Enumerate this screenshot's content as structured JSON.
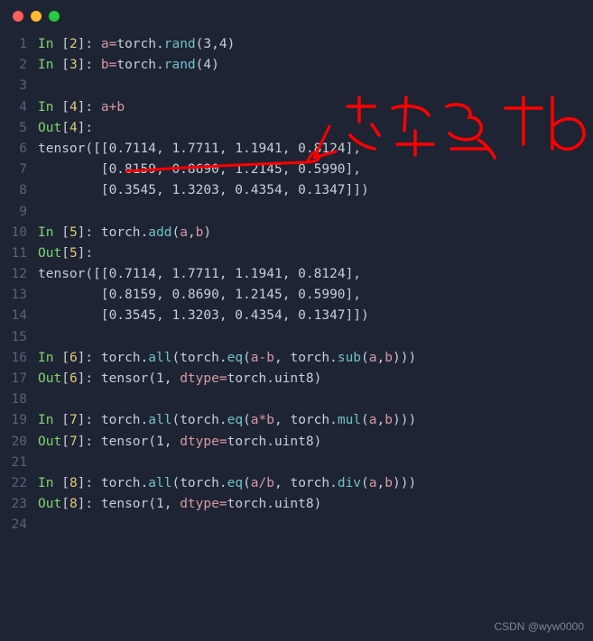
{
  "window": {
    "controls": [
      "close",
      "minimize",
      "maximize"
    ]
  },
  "lines": [
    {
      "n": "1",
      "tokens": [
        {
          "t": "In ",
          "c": "kw-in"
        },
        {
          "t": "[",
          "c": "plain"
        },
        {
          "t": "2",
          "c": "bracket-num"
        },
        {
          "t": "]: ",
          "c": "plain"
        },
        {
          "t": "a",
          "c": "var"
        },
        {
          "t": "=",
          "c": "op"
        },
        {
          "t": "torch.",
          "c": "plain"
        },
        {
          "t": "rand",
          "c": "func"
        },
        {
          "t": "(",
          "c": "paren"
        },
        {
          "t": "3",
          "c": "num"
        },
        {
          "t": ",",
          "c": "plain"
        },
        {
          "t": "4",
          "c": "num"
        },
        {
          "t": ")",
          "c": "paren"
        }
      ]
    },
    {
      "n": "2",
      "tokens": [
        {
          "t": "In ",
          "c": "kw-in"
        },
        {
          "t": "[",
          "c": "plain"
        },
        {
          "t": "3",
          "c": "bracket-num"
        },
        {
          "t": "]: ",
          "c": "plain"
        },
        {
          "t": "b",
          "c": "var"
        },
        {
          "t": "=",
          "c": "op"
        },
        {
          "t": "torch.",
          "c": "plain"
        },
        {
          "t": "rand",
          "c": "func"
        },
        {
          "t": "(",
          "c": "paren"
        },
        {
          "t": "4",
          "c": "num"
        },
        {
          "t": ")",
          "c": "paren"
        }
      ]
    },
    {
      "n": "3",
      "tokens": []
    },
    {
      "n": "4",
      "tokens": [
        {
          "t": "In ",
          "c": "kw-in"
        },
        {
          "t": "[",
          "c": "plain"
        },
        {
          "t": "4",
          "c": "bracket-num"
        },
        {
          "t": "]: ",
          "c": "plain"
        },
        {
          "t": "a",
          "c": "var"
        },
        {
          "t": "+",
          "c": "op"
        },
        {
          "t": "b",
          "c": "var"
        }
      ]
    },
    {
      "n": "5",
      "tokens": [
        {
          "t": "Out",
          "c": "kw-out"
        },
        {
          "t": "[",
          "c": "plain"
        },
        {
          "t": "4",
          "c": "bracket-num"
        },
        {
          "t": "]:",
          "c": "plain"
        }
      ]
    },
    {
      "n": "6",
      "tokens": [
        {
          "t": "tensor",
          "c": "plain"
        },
        {
          "t": "([[",
          "c": "paren"
        },
        {
          "t": "0.7114",
          "c": "num"
        },
        {
          "t": ", ",
          "c": "plain"
        },
        {
          "t": "1.7711",
          "c": "num"
        },
        {
          "t": ", ",
          "c": "plain"
        },
        {
          "t": "1.1941",
          "c": "num"
        },
        {
          "t": ", ",
          "c": "plain"
        },
        {
          "t": "0.8124",
          "c": "num"
        },
        {
          "t": "],",
          "c": "paren"
        }
      ]
    },
    {
      "n": "7",
      "tokens": [
        {
          "t": "        [",
          "c": "paren"
        },
        {
          "t": "0.8159",
          "c": "num"
        },
        {
          "t": ", ",
          "c": "plain"
        },
        {
          "t": "0.8690",
          "c": "num"
        },
        {
          "t": ", ",
          "c": "plain"
        },
        {
          "t": "1.2145",
          "c": "num"
        },
        {
          "t": ", ",
          "c": "plain"
        },
        {
          "t": "0.5990",
          "c": "num"
        },
        {
          "t": "],",
          "c": "paren"
        }
      ]
    },
    {
      "n": "8",
      "tokens": [
        {
          "t": "        [",
          "c": "paren"
        },
        {
          "t": "0.3545",
          "c": "num"
        },
        {
          "t": ", ",
          "c": "plain"
        },
        {
          "t": "1.3203",
          "c": "num"
        },
        {
          "t": ", ",
          "c": "plain"
        },
        {
          "t": "0.4354",
          "c": "num"
        },
        {
          "t": ", ",
          "c": "plain"
        },
        {
          "t": "0.1347",
          "c": "num"
        },
        {
          "t": "]])",
          "c": "paren"
        }
      ]
    },
    {
      "n": "9",
      "tokens": []
    },
    {
      "n": "10",
      "tokens": [
        {
          "t": "In ",
          "c": "kw-in"
        },
        {
          "t": "[",
          "c": "plain"
        },
        {
          "t": "5",
          "c": "bracket-num"
        },
        {
          "t": "]: ",
          "c": "plain"
        },
        {
          "t": "torch.",
          "c": "plain"
        },
        {
          "t": "add",
          "c": "func"
        },
        {
          "t": "(",
          "c": "paren"
        },
        {
          "t": "a",
          "c": "var"
        },
        {
          "t": ",",
          "c": "plain"
        },
        {
          "t": "b",
          "c": "var"
        },
        {
          "t": ")",
          "c": "paren"
        }
      ]
    },
    {
      "n": "11",
      "tokens": [
        {
          "t": "Out",
          "c": "kw-out"
        },
        {
          "t": "[",
          "c": "plain"
        },
        {
          "t": "5",
          "c": "bracket-num"
        },
        {
          "t": "]:",
          "c": "plain"
        }
      ]
    },
    {
      "n": "12",
      "tokens": [
        {
          "t": "tensor",
          "c": "plain"
        },
        {
          "t": "([[",
          "c": "paren"
        },
        {
          "t": "0.7114",
          "c": "num"
        },
        {
          "t": ", ",
          "c": "plain"
        },
        {
          "t": "1.7711",
          "c": "num"
        },
        {
          "t": ", ",
          "c": "plain"
        },
        {
          "t": "1.1941",
          "c": "num"
        },
        {
          "t": ", ",
          "c": "plain"
        },
        {
          "t": "0.8124",
          "c": "num"
        },
        {
          "t": "],",
          "c": "paren"
        }
      ]
    },
    {
      "n": "13",
      "tokens": [
        {
          "t": "        [",
          "c": "paren"
        },
        {
          "t": "0.8159",
          "c": "num"
        },
        {
          "t": ", ",
          "c": "plain"
        },
        {
          "t": "0.8690",
          "c": "num"
        },
        {
          "t": ", ",
          "c": "plain"
        },
        {
          "t": "1.2145",
          "c": "num"
        },
        {
          "t": ", ",
          "c": "plain"
        },
        {
          "t": "0.5990",
          "c": "num"
        },
        {
          "t": "],",
          "c": "paren"
        }
      ]
    },
    {
      "n": "14",
      "tokens": [
        {
          "t": "        [",
          "c": "paren"
        },
        {
          "t": "0.3545",
          "c": "num"
        },
        {
          "t": ", ",
          "c": "plain"
        },
        {
          "t": "1.3203",
          "c": "num"
        },
        {
          "t": ", ",
          "c": "plain"
        },
        {
          "t": "0.4354",
          "c": "num"
        },
        {
          "t": ", ",
          "c": "plain"
        },
        {
          "t": "0.1347",
          "c": "num"
        },
        {
          "t": "]])",
          "c": "paren"
        }
      ]
    },
    {
      "n": "15",
      "tokens": []
    },
    {
      "n": "16",
      "tokens": [
        {
          "t": "In ",
          "c": "kw-in"
        },
        {
          "t": "[",
          "c": "plain"
        },
        {
          "t": "6",
          "c": "bracket-num"
        },
        {
          "t": "]: ",
          "c": "plain"
        },
        {
          "t": "torch.",
          "c": "plain"
        },
        {
          "t": "all",
          "c": "func"
        },
        {
          "t": "(",
          "c": "paren"
        },
        {
          "t": "torch.",
          "c": "plain"
        },
        {
          "t": "eq",
          "c": "func"
        },
        {
          "t": "(",
          "c": "paren"
        },
        {
          "t": "a",
          "c": "var"
        },
        {
          "t": "-",
          "c": "op"
        },
        {
          "t": "b",
          "c": "var"
        },
        {
          "t": ", torch.",
          "c": "plain"
        },
        {
          "t": "sub",
          "c": "func"
        },
        {
          "t": "(",
          "c": "paren"
        },
        {
          "t": "a",
          "c": "var"
        },
        {
          "t": ",",
          "c": "plain"
        },
        {
          "t": "b",
          "c": "var"
        },
        {
          "t": ")))",
          "c": "paren"
        }
      ]
    },
    {
      "n": "17",
      "tokens": [
        {
          "t": "Out",
          "c": "kw-out"
        },
        {
          "t": "[",
          "c": "plain"
        },
        {
          "t": "6",
          "c": "bracket-num"
        },
        {
          "t": "]: ",
          "c": "plain"
        },
        {
          "t": "tensor",
          "c": "plain"
        },
        {
          "t": "(",
          "c": "paren"
        },
        {
          "t": "1",
          "c": "num"
        },
        {
          "t": ", ",
          "c": "plain"
        },
        {
          "t": "dtype",
          "c": "var"
        },
        {
          "t": "=",
          "c": "op"
        },
        {
          "t": "torch.uint8",
          "c": "plain"
        },
        {
          "t": ")",
          "c": "paren"
        }
      ]
    },
    {
      "n": "18",
      "tokens": []
    },
    {
      "n": "19",
      "tokens": [
        {
          "t": "In ",
          "c": "kw-in"
        },
        {
          "t": "[",
          "c": "plain"
        },
        {
          "t": "7",
          "c": "bracket-num"
        },
        {
          "t": "]: ",
          "c": "plain"
        },
        {
          "t": "torch.",
          "c": "plain"
        },
        {
          "t": "all",
          "c": "func"
        },
        {
          "t": "(",
          "c": "paren"
        },
        {
          "t": "torch.",
          "c": "plain"
        },
        {
          "t": "eq",
          "c": "func"
        },
        {
          "t": "(",
          "c": "paren"
        },
        {
          "t": "a",
          "c": "var"
        },
        {
          "t": "*",
          "c": "op"
        },
        {
          "t": "b",
          "c": "var"
        },
        {
          "t": ", torch.",
          "c": "plain"
        },
        {
          "t": "mul",
          "c": "func"
        },
        {
          "t": "(",
          "c": "paren"
        },
        {
          "t": "a",
          "c": "var"
        },
        {
          "t": ",",
          "c": "plain"
        },
        {
          "t": "b",
          "c": "var"
        },
        {
          "t": ")))",
          "c": "paren"
        }
      ]
    },
    {
      "n": "20",
      "tokens": [
        {
          "t": "Out",
          "c": "kw-out"
        },
        {
          "t": "[",
          "c": "plain"
        },
        {
          "t": "7",
          "c": "bracket-num"
        },
        {
          "t": "]: ",
          "c": "plain"
        },
        {
          "t": "tensor",
          "c": "plain"
        },
        {
          "t": "(",
          "c": "paren"
        },
        {
          "t": "1",
          "c": "num"
        },
        {
          "t": ", ",
          "c": "plain"
        },
        {
          "t": "dtype",
          "c": "var"
        },
        {
          "t": "=",
          "c": "op"
        },
        {
          "t": "torch.uint8",
          "c": "plain"
        },
        {
          "t": ")",
          "c": "paren"
        }
      ]
    },
    {
      "n": "21",
      "tokens": []
    },
    {
      "n": "22",
      "tokens": [
        {
          "t": "In ",
          "c": "kw-in"
        },
        {
          "t": "[",
          "c": "plain"
        },
        {
          "t": "8",
          "c": "bracket-num"
        },
        {
          "t": "]: ",
          "c": "plain"
        },
        {
          "t": "torch.",
          "c": "plain"
        },
        {
          "t": "all",
          "c": "func"
        },
        {
          "t": "(",
          "c": "paren"
        },
        {
          "t": "torch.",
          "c": "plain"
        },
        {
          "t": "eq",
          "c": "func"
        },
        {
          "t": "(",
          "c": "paren"
        },
        {
          "t": "a",
          "c": "var"
        },
        {
          "t": "/",
          "c": "op"
        },
        {
          "t": "b",
          "c": "var"
        },
        {
          "t": ", torch.",
          "c": "plain"
        },
        {
          "t": "div",
          "c": "func"
        },
        {
          "t": "(",
          "c": "paren"
        },
        {
          "t": "a",
          "c": "var"
        },
        {
          "t": ",",
          "c": "plain"
        },
        {
          "t": "b",
          "c": "var"
        },
        {
          "t": ")))",
          "c": "paren"
        }
      ]
    },
    {
      "n": "23",
      "tokens": [
        {
          "t": "Out",
          "c": "kw-out"
        },
        {
          "t": "[",
          "c": "plain"
        },
        {
          "t": "8",
          "c": "bracket-num"
        },
        {
          "t": "]: ",
          "c": "plain"
        },
        {
          "t": "tensor",
          "c": "plain"
        },
        {
          "t": "(",
          "c": "paren"
        },
        {
          "t": "1",
          "c": "num"
        },
        {
          "t": ", ",
          "c": "plain"
        },
        {
          "t": "dtype",
          "c": "var"
        },
        {
          "t": "=",
          "c": "op"
        },
        {
          "t": "torch.uint8",
          "c": "plain"
        },
        {
          "t": ")",
          "c": "paren"
        }
      ]
    },
    {
      "n": "24",
      "tokens": []
    }
  ],
  "annotation": {
    "text": "每行都+b",
    "color": "#ff0000"
  },
  "watermark": "CSDN @wyw0000"
}
